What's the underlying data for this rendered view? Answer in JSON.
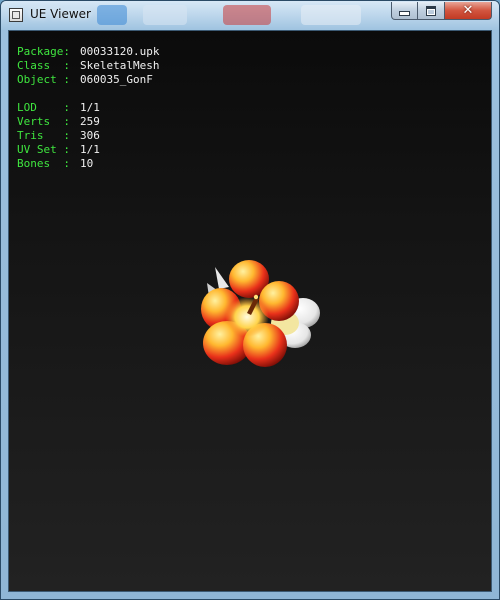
{
  "window": {
    "title": "UE Viewer",
    "close_glyph": "✕"
  },
  "info": {
    "object_rows": [
      {
        "label": "Package:",
        "value": "00033120.upk"
      },
      {
        "label": "Class  :",
        "value": "SkeletalMesh"
      },
      {
        "label": "Object :",
        "value": "060035_GonF"
      }
    ],
    "stat_rows": [
      {
        "label": "LOD    :",
        "value": "1/1"
      },
      {
        "label": "Verts  :",
        "value": "259"
      },
      {
        "label": "Tris   :",
        "value": "306"
      },
      {
        "label": "UV Set :",
        "value": "1/1"
      },
      {
        "label": "Bones  :",
        "value": "10"
      }
    ]
  },
  "colors": {
    "label_green": "#3fe63f",
    "value_white": "#f0f0f0",
    "viewport_top": "#0b0b0b",
    "viewport_bottom": "#222222"
  },
  "icons": {
    "app": "app-window-icon",
    "minimize": "minimize-icon",
    "maximize": "maximize-icon",
    "close": "close-icon"
  }
}
